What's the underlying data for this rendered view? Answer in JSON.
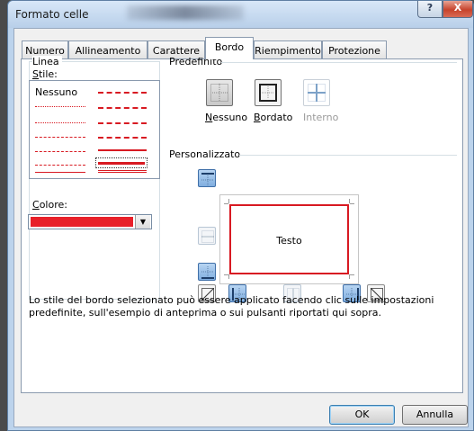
{
  "window": {
    "title": "Formato celle",
    "help_glyph": "?",
    "close_glyph": "X"
  },
  "tabs": [
    {
      "label": "Numero"
    },
    {
      "label": "Allineamento"
    },
    {
      "label": "Carattere"
    },
    {
      "label": "Bordo",
      "selected": true
    },
    {
      "label": "Riempimento"
    },
    {
      "label": "Protezione"
    }
  ],
  "linea": {
    "group_label": "Linea",
    "stile_label": "Stile:",
    "none_label": "Nessuno",
    "colore_label": "Colore:",
    "color_value": "#e8202a"
  },
  "predefinito": {
    "group_label": "Predefinito",
    "presets": [
      {
        "label": "Nessuno",
        "icon": "border-none-icon"
      },
      {
        "label": "Bordato",
        "icon": "border-outline-icon"
      },
      {
        "label": "Interno",
        "icon": "border-inside-icon",
        "disabled": true
      }
    ]
  },
  "personalizzato": {
    "group_label": "Personalizzato",
    "preview_text": "Testo"
  },
  "description": "Lo stile del bordo selezionato può essere applicato facendo clic sulle impostazioni predefinite, sull'esempio di anteprima o sui pulsanti riportati qui sopra.",
  "buttons": {
    "ok": "OK",
    "cancel": "Annulla"
  },
  "colors": {
    "accent": "#d81a22",
    "title_bar": "#bcd3ec",
    "selected_button": "#9cc2ea"
  }
}
